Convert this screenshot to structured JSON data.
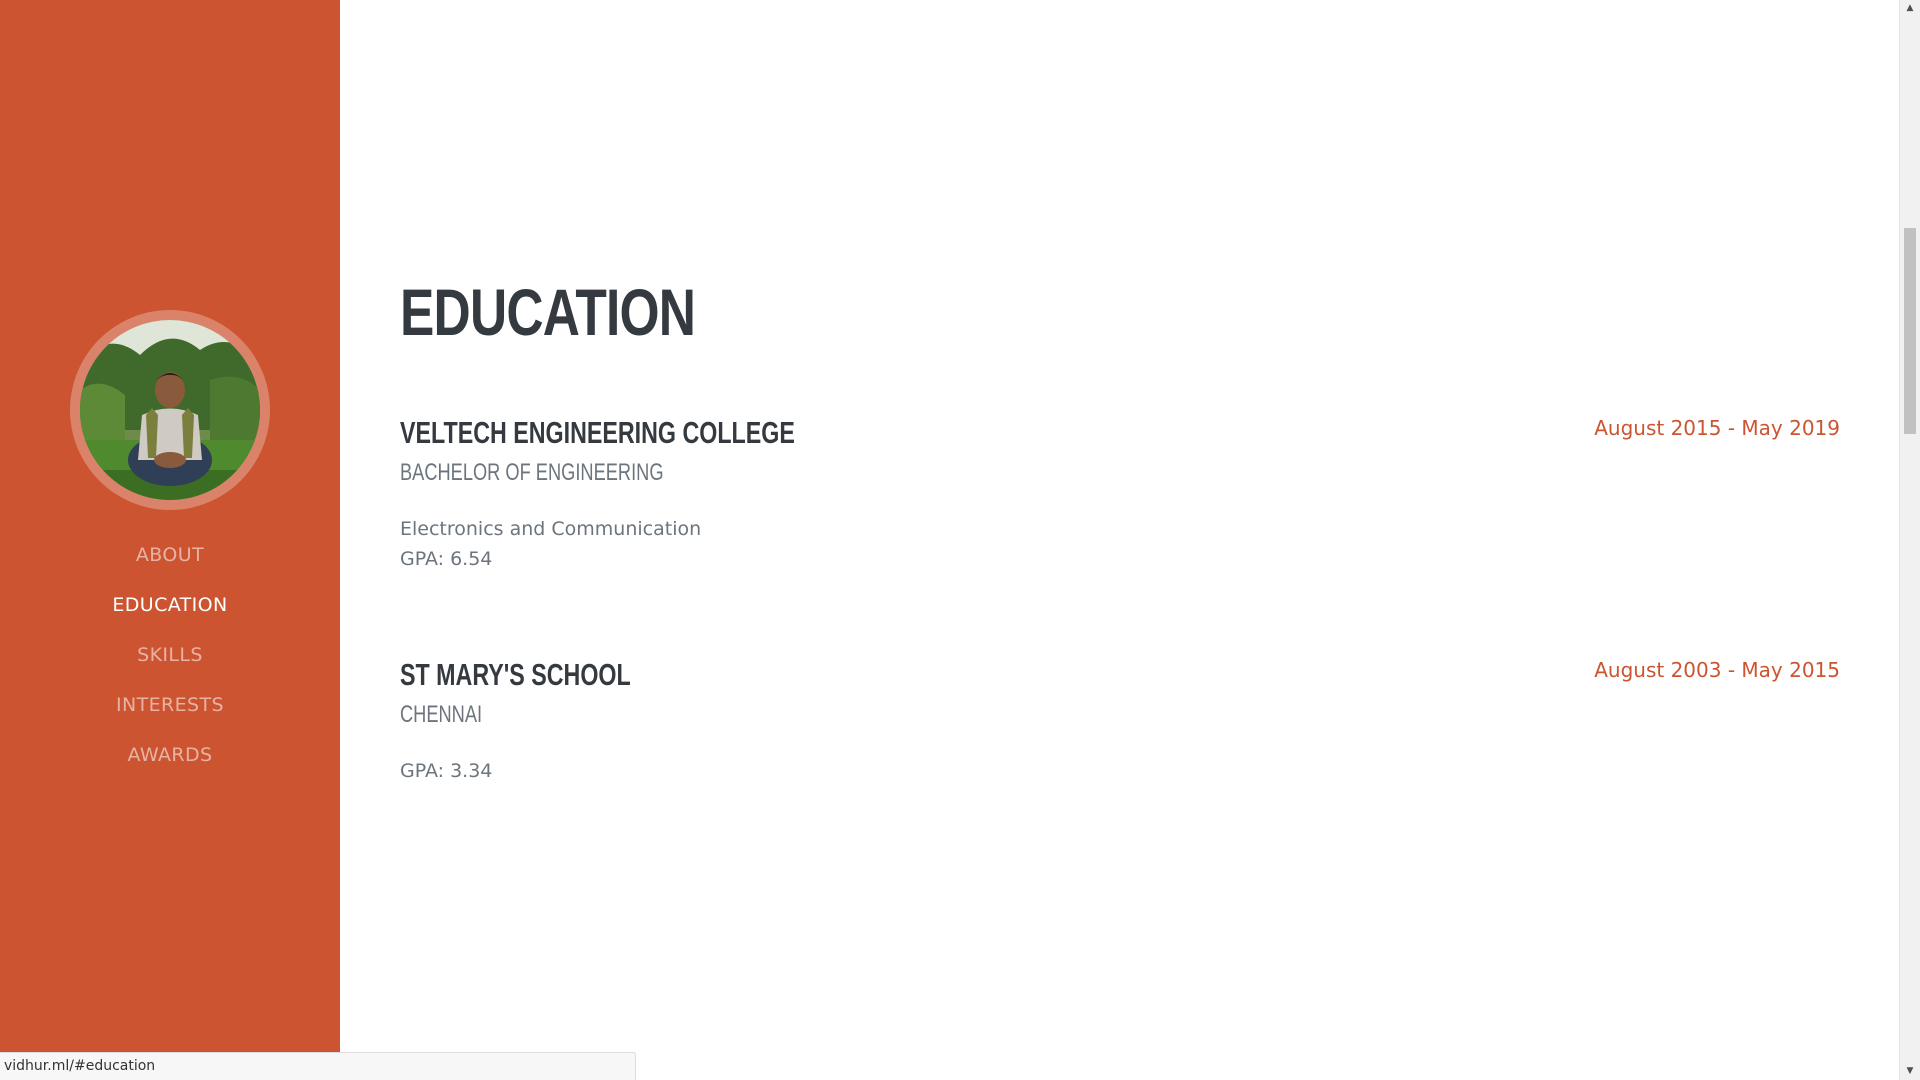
{
  "colors": {
    "accent": "#cc5431",
    "heading": "#343a40",
    "muted": "#6c757d"
  },
  "sidebar": {
    "avatar_alt": "profile photo",
    "nav": [
      {
        "label": "ABOUT",
        "active": false
      },
      {
        "label": "EDUCATION",
        "active": true
      },
      {
        "label": "SKILLS",
        "active": false
      },
      {
        "label": "INTERESTS",
        "active": false
      },
      {
        "label": "AWARDS",
        "active": false
      }
    ]
  },
  "education": {
    "title": "EDUCATION",
    "entries": [
      {
        "school": "VELTECH ENGINEERING COLLEGE",
        "subtitle": "BACHELOR OF ENGINEERING",
        "details": [
          "Electronics and Communication",
          "GPA: 6.54"
        ],
        "date": "August 2015 - May 2019"
      },
      {
        "school": "ST MARY'S SCHOOL",
        "subtitle": "CHENNAI",
        "details": [
          "GPA: 3.34"
        ],
        "date": "August 2003 - May 2015"
      }
    ]
  },
  "status_bar": {
    "url": "vidhur.ml/#education"
  }
}
